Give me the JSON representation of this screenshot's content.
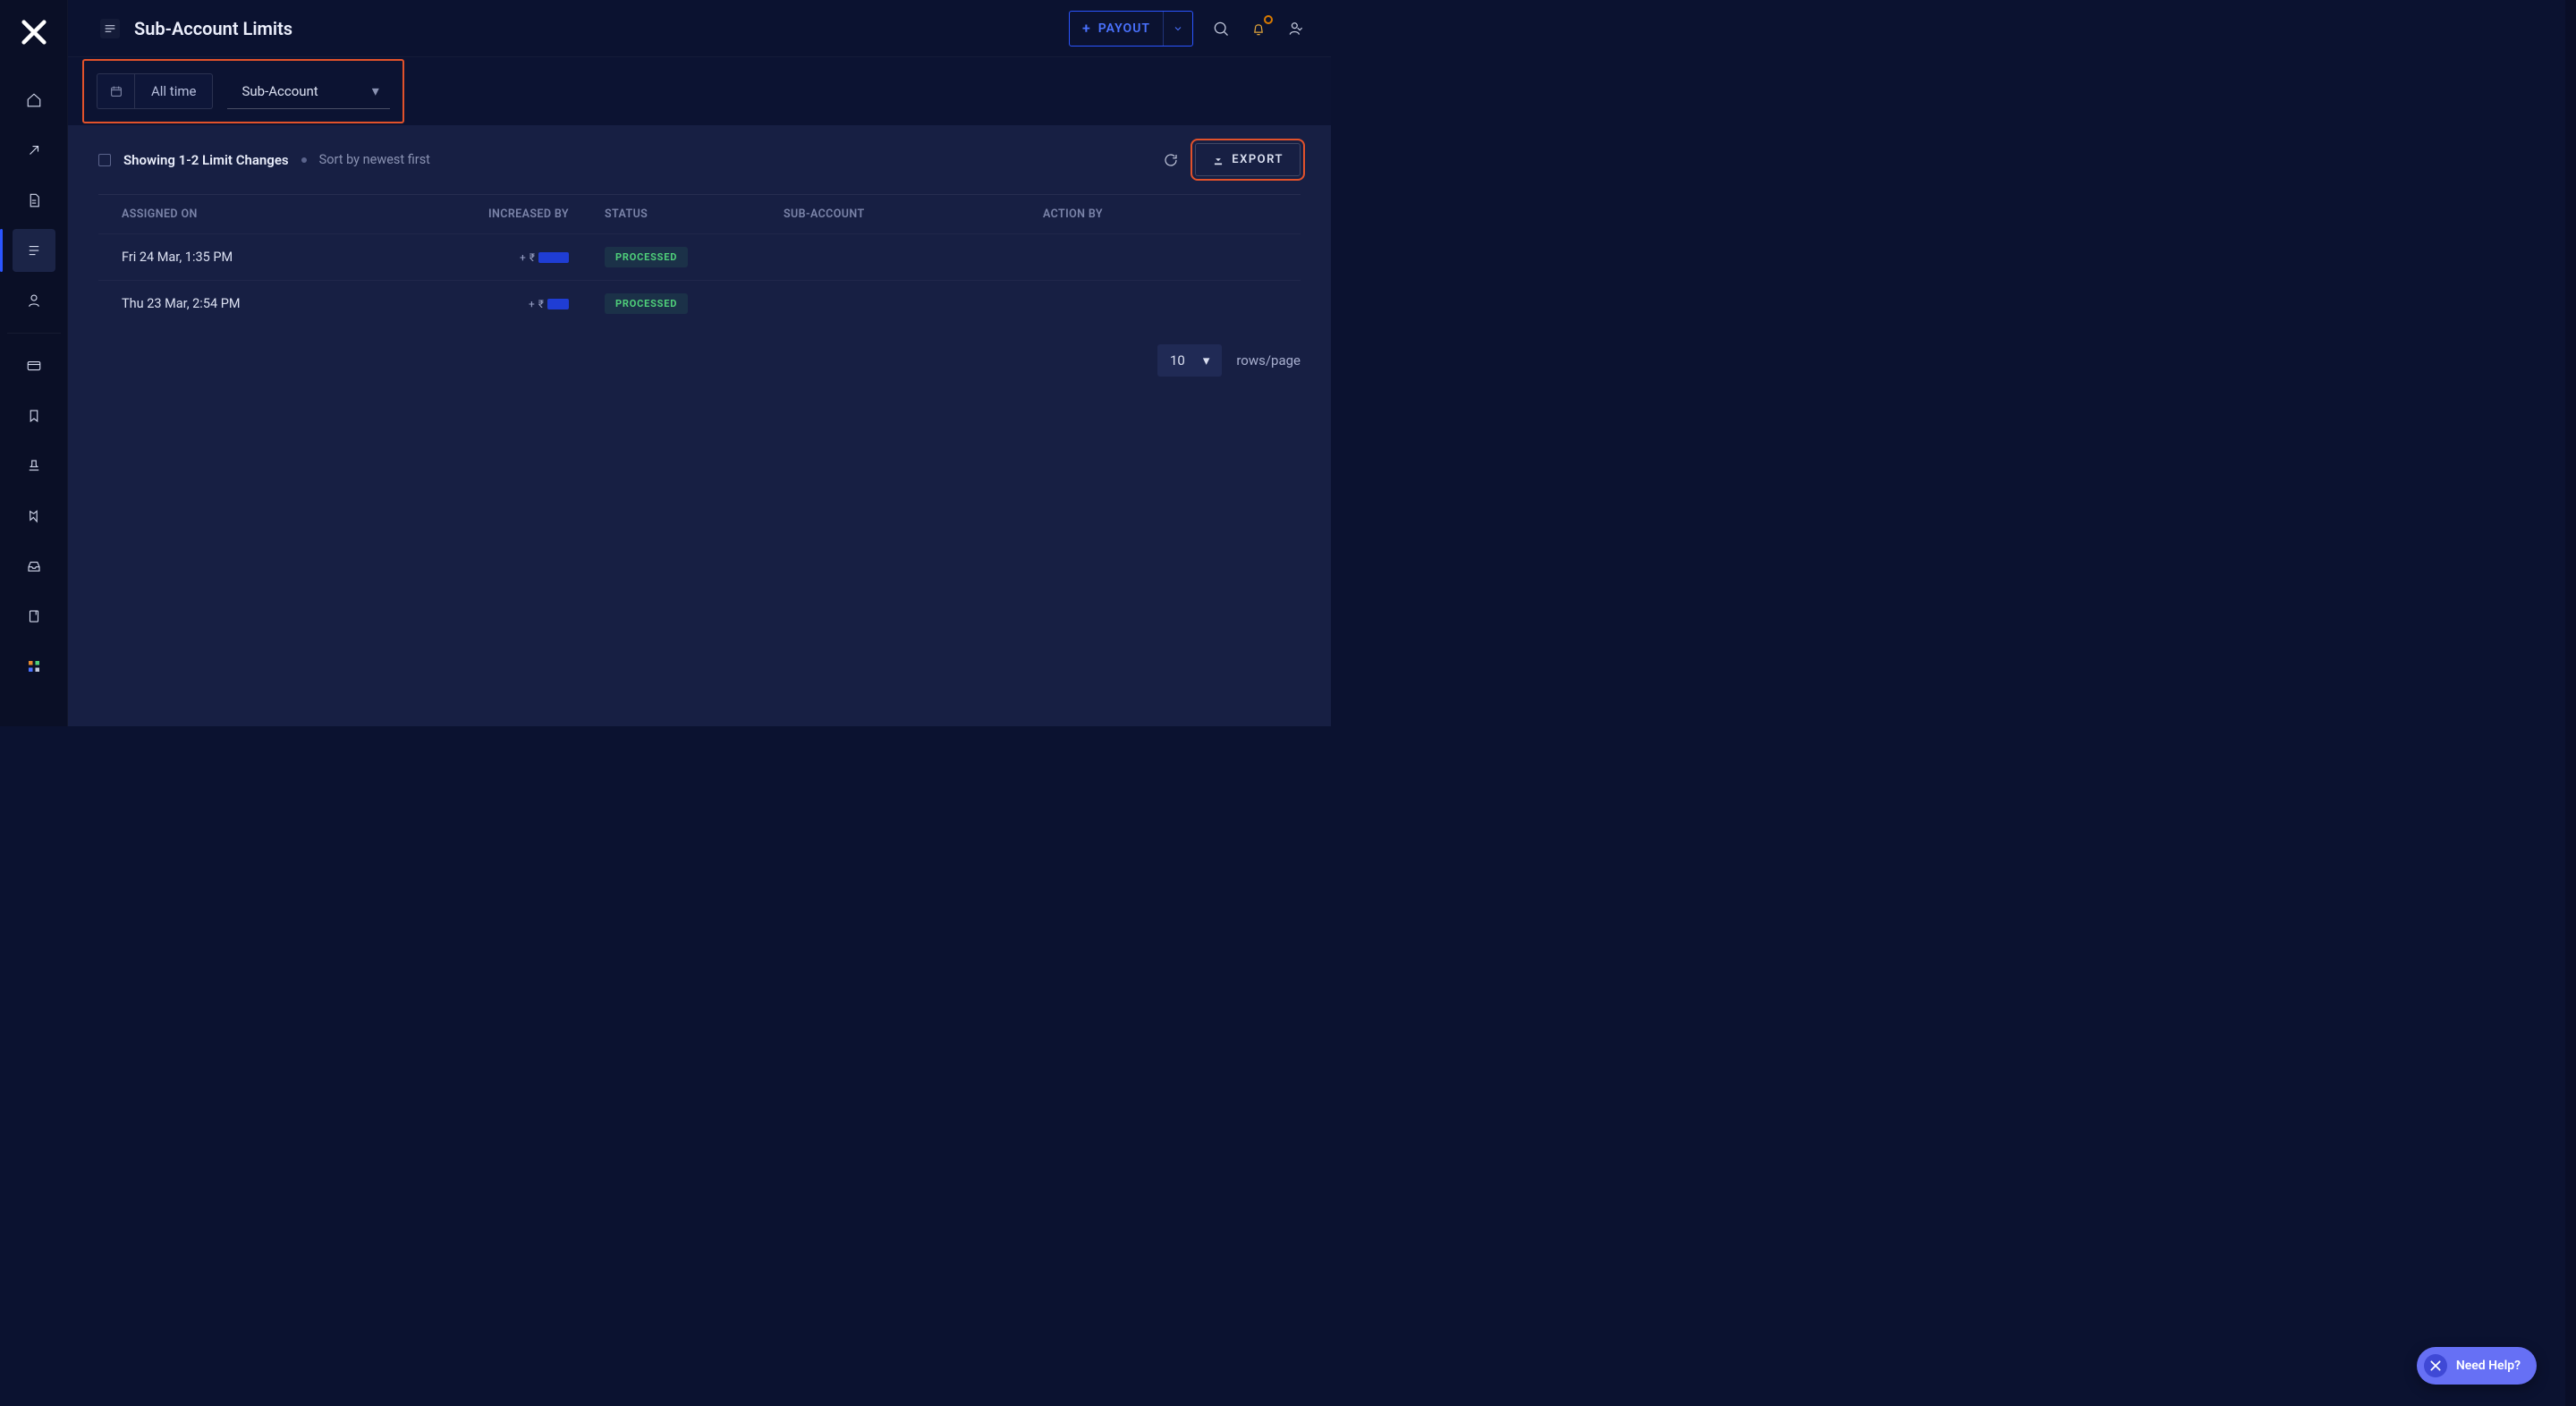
{
  "header": {
    "title": "Sub-Account Limits",
    "payout_label": "PAYOUT"
  },
  "filters": {
    "date_label": "All time",
    "subaccount_label": "Sub-Account"
  },
  "list": {
    "showing_text": "Showing 1-2 Limit Changes",
    "sort_text": "Sort by newest first",
    "export_label": "EXPORT",
    "columns": {
      "assigned_on": "ASSIGNED ON",
      "increased_by": "INCREASED BY",
      "status": "STATUS",
      "sub_account": "SUB-ACCOUNT",
      "action_by": "ACTION BY"
    },
    "rows": [
      {
        "assigned_on": "Fri 24 Mar, 1:35 PM",
        "amount_prefix": "+",
        "currency": "₹",
        "amount_redacted_width": 34,
        "status": "PROCESSED",
        "subacct_redacted_width": 80,
        "actionby_redacted_width": 96
      },
      {
        "assigned_on": "Thu 23 Mar, 2:54 PM",
        "amount_prefix": "+",
        "currency": "₹",
        "amount_redacted_width": 24,
        "status": "PROCESSED",
        "subacct_redacted_width": 74,
        "actionby_redacted_width": 94
      }
    ]
  },
  "pager": {
    "rows_per_page_value": "10",
    "rows_per_page_label": "rows/page"
  },
  "help": {
    "label": "Need Help?"
  },
  "colors": {
    "accent_blue": "#2b55ff",
    "highlight_orange": "#e2522b",
    "status_green": "#4fd07a",
    "redacted_blue": "#1f3dd4"
  }
}
